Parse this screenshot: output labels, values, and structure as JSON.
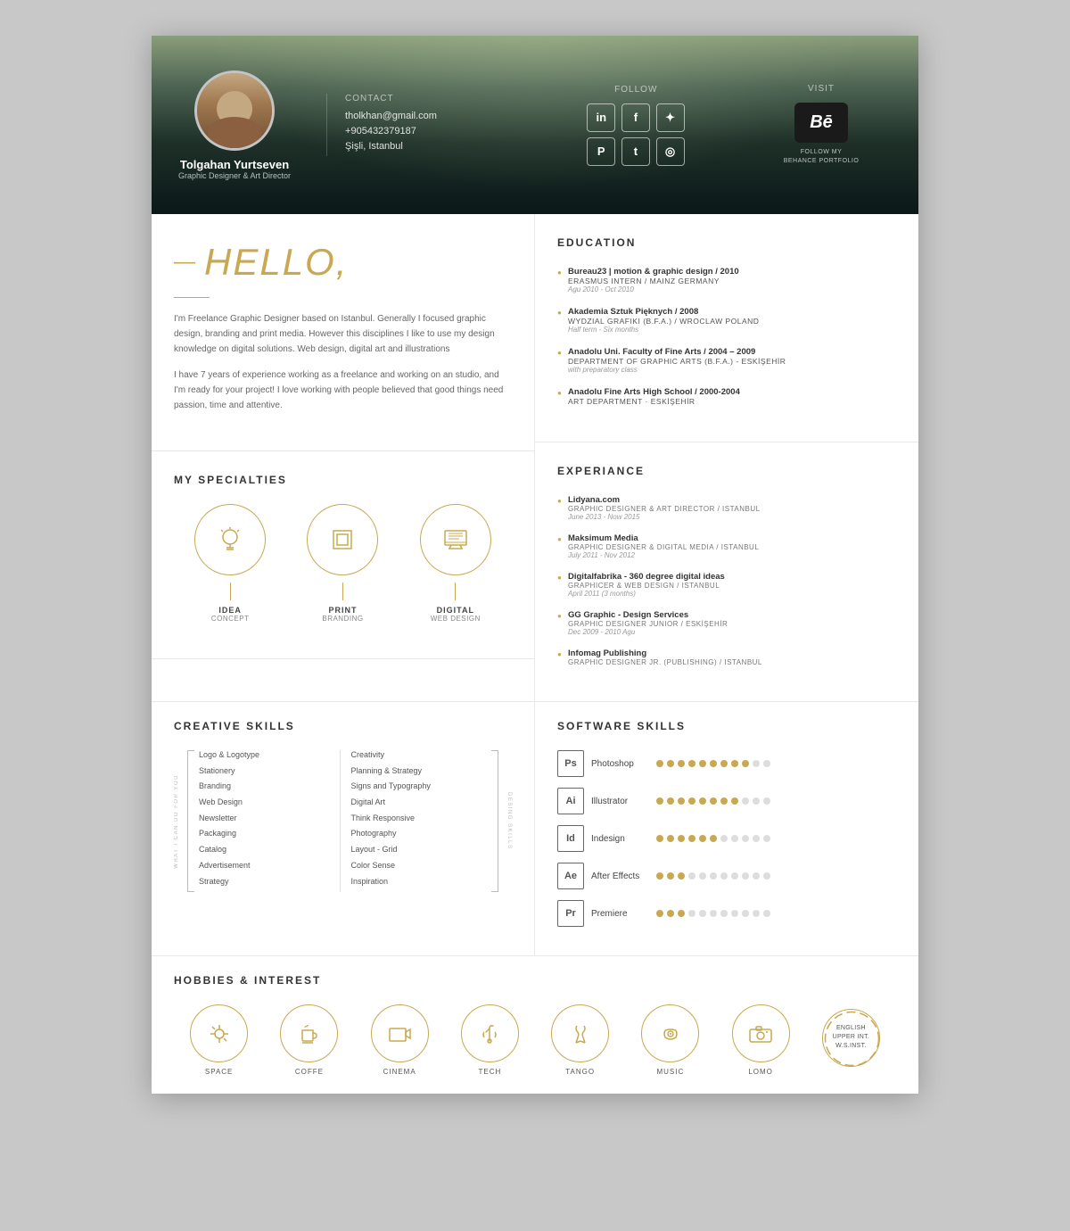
{
  "header": {
    "name": "Tolgahan Yurtseven",
    "title": "Graphic Designer & Art Director",
    "contact": {
      "label": "Contact",
      "email": "tholkhan@gmail.com",
      "phone": "+905432379187",
      "location": "Şişli, Istanbul"
    },
    "follow": {
      "label": "Follow",
      "socials": [
        "in",
        "f",
        "✦",
        "𝐏",
        "t",
        "📷"
      ]
    },
    "visit": {
      "label": "Visit",
      "behance_symbol": "Bē",
      "behance_text": "FOLLOW MY\nBEHANCE PORTFOLIO"
    }
  },
  "hello": {
    "dash": "—",
    "heading": "HELLO,",
    "bio1": "I'm Freelance Graphic Designer based on Istanbul. Generally I focused graphic design, branding and print media. However this disciplines I like to use my design knowledge on digital solutions. Web design, digital art and illustrations",
    "bio2": "I have 7 years of experience working as a freelance and working on an studio, and I'm ready for your project! I love working with people believed that good things need passion, time and attentive."
  },
  "specialties": {
    "title": "MY SPECIALTIES",
    "items": [
      {
        "label": "IDEA",
        "sub": "CONCEPT",
        "icon": "💡"
      },
      {
        "label": "PRINT",
        "sub": "BRANDING",
        "icon": "⬜"
      },
      {
        "label": "DIGITAL",
        "sub": "WEB DESIGN",
        "icon": "🖥"
      }
    ]
  },
  "education": {
    "title": "EDUCATION",
    "items": [
      {
        "title": "Bureau23 | motion & graphic design / 2010",
        "subtitle": "ERASMUS INTERN / MAINZ GERMANY",
        "date": "Agu 2010 - Oct 2010"
      },
      {
        "title": "Akademia Sztuk Pięknych / 2008",
        "subtitle": "WYDZIAL GRAFIKI (B.F.A.) / WROCLAW POLAND",
        "date": "Half term - Six months"
      },
      {
        "title": "Anadolu Uni. Faculty of Fine Arts / 2004 – 2009",
        "subtitle": "DEPARTMENT OF GRAPHIC ARTS (B.F.A.) - ESKİŞEHİR",
        "date": "with preparatory class"
      },
      {
        "title": "Anadolu Fine Arts High School / 2000-2004",
        "subtitle": "ART DEPARTMENT · ESKİŞEHİR",
        "date": ""
      }
    ]
  },
  "experience": {
    "title": "EXPERIANCE",
    "items": [
      {
        "title": "Lidyana.com",
        "subtitle": "GRAPHIC DESIGNER & ART DIRECTOR / ISTANBUL",
        "date": "June 2013 - Now 2015"
      },
      {
        "title": "Maksimum Media",
        "subtitle": "GRAPHIC DESIGNER & DIGITAL MEDIA / ISTANBUL",
        "date": "July 2011 - Nov 2012"
      },
      {
        "title": "Digitalfabrika - 360 degree digital ideas",
        "subtitle": "GRAPHICER & WEB DESIGN / ISTANBUL",
        "date": "April 2011 (3 months)"
      },
      {
        "title": "GG Graphic - Design Services",
        "subtitle": "GRAPHIC DESIGNER JUNIOR / ESKİŞEHİR",
        "date": "Dec 2009 - 2010 Agu"
      },
      {
        "title": "Infomag Publishing",
        "subtitle": "GRAPHIC DESIGNER JR. (PUBLISHING) / ISTANBUL",
        "date": ""
      }
    ]
  },
  "creative_skills": {
    "title": "CREATIVE SKILLS",
    "left_label": "WHAT I CAN DO FOR YOU",
    "right_label": "DESING SKILLS",
    "left_items": [
      "Logo & Logotype",
      "Stationery",
      "Branding",
      "Web Design",
      "Newsletter",
      "Packaging",
      "Catalog",
      "Advertisement",
      "Strategy"
    ],
    "right_items": [
      "Creativity",
      "Planning & Strategy",
      "Signs and Typography",
      "Digital Art",
      "Think Responsive",
      "Photography",
      "Layout - Grid",
      "Color Sense",
      "Inspiration"
    ]
  },
  "software_skills": {
    "title": "SOFTWARE SKILLS",
    "items": [
      {
        "name": "Photoshop",
        "abbr": "Ps",
        "filled": 9,
        "empty": 2
      },
      {
        "name": "Illustrator",
        "abbr": "Ai",
        "filled": 8,
        "empty": 3
      },
      {
        "name": "Indesign",
        "abbr": "Id",
        "filled": 6,
        "empty": 5
      },
      {
        "name": "After Effects",
        "abbr": "Ae",
        "filled": 3,
        "empty": 8
      },
      {
        "name": "Premiere",
        "abbr": "Pr",
        "filled": 3,
        "empty": 8
      }
    ]
  },
  "hobbies": {
    "title": "HOBBIES & INTEREST",
    "items": [
      {
        "label": "SPACE",
        "icon": "🔭"
      },
      {
        "label": "COFFE",
        "icon": "☕"
      },
      {
        "label": "CINEMA",
        "icon": "🎬"
      },
      {
        "label": "TECH",
        "icon": "🚀"
      },
      {
        "label": "TANGO",
        "icon": "👠"
      },
      {
        "label": "MUSIC",
        "icon": "🎧"
      },
      {
        "label": "LOMO",
        "icon": "📷"
      }
    ],
    "language": {
      "text": "ENGLISH\nUPPER INT.\nW.S.INST."
    }
  }
}
